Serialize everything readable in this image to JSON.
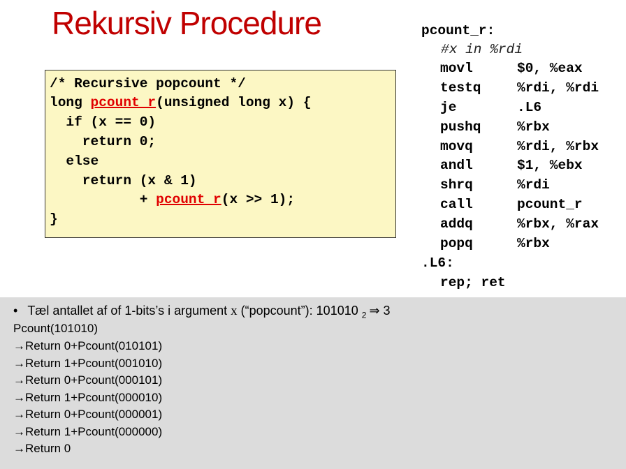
{
  "slide": {
    "title": "Rekursiv Procedure"
  },
  "c_code": {
    "line1": "/* Recursive popcount */",
    "line2_pre": "long ",
    "line2_fn": "pcount_r",
    "line2_post": "(unsigned long x) {",
    "line3": "  if (x == 0)",
    "line4": "    return 0;",
    "line5": "  else",
    "line6": "    return (x & 1)",
    "line7_pre": "           + ",
    "line7_fn": "pcount_r",
    "line7_post": "(x >> 1);",
    "line8": "}"
  },
  "assembly": {
    "label": "pcount_r:",
    "comment": "#x in %rdi",
    "instructions": [
      {
        "op": "movl",
        "args": "$0, %eax"
      },
      {
        "op": "testq",
        "args": "%rdi, %rdi"
      },
      {
        "op": "je",
        "args": ".L6"
      },
      {
        "op": "pushq",
        "args": "%rbx"
      },
      {
        "op": "movq",
        "args": "%rdi, %rbx"
      },
      {
        "op": "andl",
        "args": "$1, %ebx"
      },
      {
        "op": "shrq",
        "args": "%rdi"
      },
      {
        "op": "call",
        "args": "pcount_r"
      },
      {
        "op": "addq",
        "args": "%rbx, %rax"
      },
      {
        "op": "popq",
        "args": "%rbx"
      }
    ],
    "label2": ".L6:",
    "last": "rep; ret"
  },
  "explanation": {
    "bullet_char": "•",
    "bullet_pre": "Tæl antallet af of 1-bits’s i argument ",
    "bullet_x": "x",
    "bullet_post": " (“popcount”): 101010 ",
    "bullet_sub": "2",
    "bullet_arrow": "⇒",
    "bullet_result": "3",
    "call_line": "Pcount(101010)",
    "arrow": "→",
    "steps": [
      "Return 0+Pcount(010101)",
      "Return 1+Pcount(001010)",
      "Return 0+Pcount(000101)",
      "Return 1+Pcount(000010)",
      "Return 0+Pcount(000001)",
      "Return 1+Pcount(000000)",
      "Return 0"
    ]
  }
}
